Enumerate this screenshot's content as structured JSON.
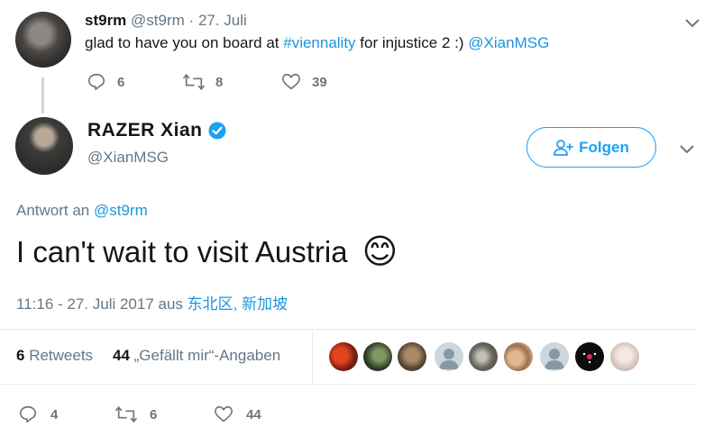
{
  "parent": {
    "name": "st9rm",
    "handle": "@st9rm",
    "sep": "·",
    "date": "27. Juli",
    "text_prefix": "glad to have you on board at ",
    "hashtag": "#viennality",
    "text_mid": " for injustice 2 :) ",
    "mention": "@XianMSG",
    "replies": "6",
    "retweets": "8",
    "likes": "39"
  },
  "tweet": {
    "name": "RAZER Xian",
    "handle": "@XianMSG",
    "follow_label": "Folgen",
    "reply_label": "Antwort an ",
    "reply_to": "@st9rm",
    "text": "I can't wait to visit Austria",
    "emoji": "😊",
    "timestamp": "11:16 - 27. Juli 2017 aus ",
    "location": "东北区, 新加坡",
    "retweet_count": "6",
    "retweet_label": " Retweets",
    "like_count": "44",
    "like_label": " „Gefällt mir“-Angaben",
    "replies": "4",
    "retweets": "6",
    "likes": "44"
  },
  "icons": [
    "chevron-down-icon",
    "reply-icon",
    "retweet-icon",
    "heart-icon",
    "verified-icon",
    "follow-person-icon"
  ],
  "colors": {
    "accent": "#1da1f2",
    "link": "#1b95e0",
    "muted": "#657786",
    "verified": "#1da1f2"
  }
}
